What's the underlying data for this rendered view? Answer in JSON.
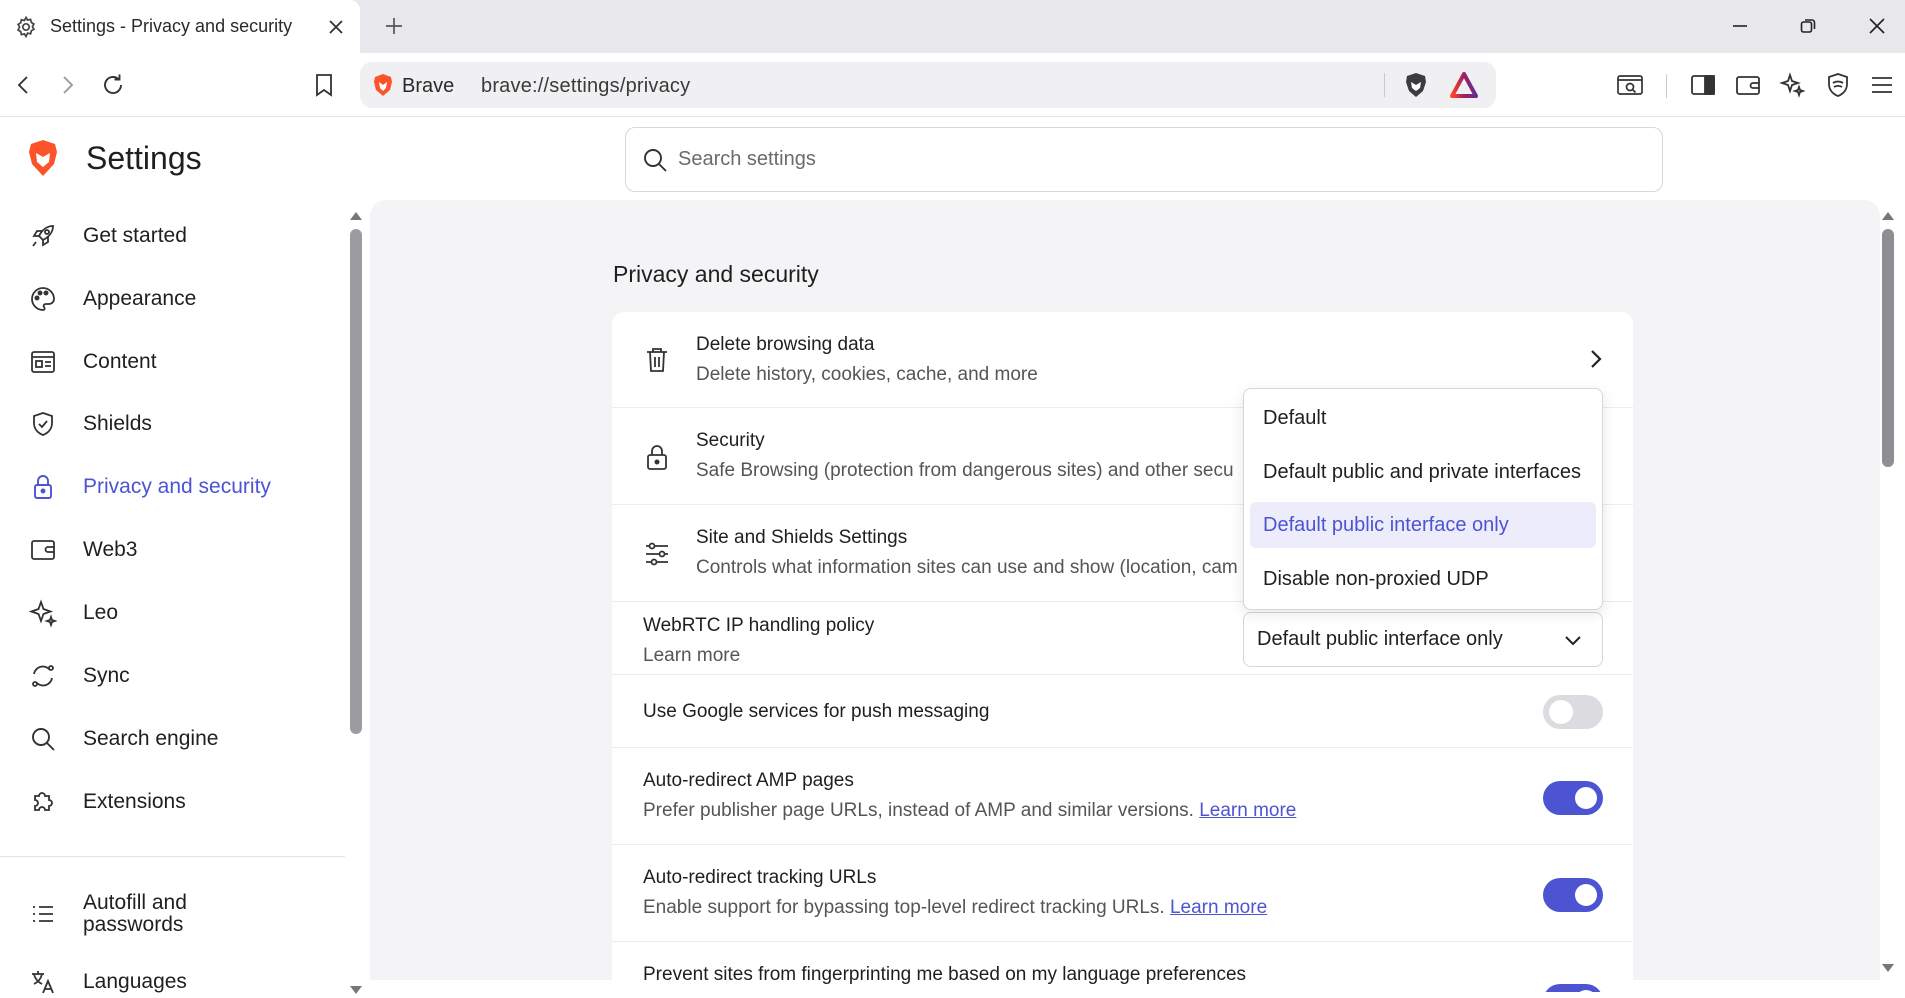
{
  "browser": {
    "tab_title": "Settings - Privacy and security",
    "brand_label": "Brave",
    "url": "brave://settings/privacy"
  },
  "settings": {
    "app_title": "Settings",
    "search_placeholder": "Search settings"
  },
  "sidebar": {
    "items": [
      {
        "label": "Get started",
        "icon": "rocket-icon"
      },
      {
        "label": "Appearance",
        "icon": "palette-icon"
      },
      {
        "label": "Content",
        "icon": "content-icon"
      },
      {
        "label": "Shields",
        "icon": "shield-icon"
      },
      {
        "label": "Privacy and security",
        "icon": "lock-icon",
        "active": true
      },
      {
        "label": "Web3",
        "icon": "wallet-icon"
      },
      {
        "label": "Leo",
        "icon": "sparkle-icon"
      },
      {
        "label": "Sync",
        "icon": "sync-icon"
      },
      {
        "label": "Search engine",
        "icon": "search-icon"
      },
      {
        "label": "Extensions",
        "icon": "puzzle-icon"
      }
    ],
    "secondary": [
      {
        "label": "Autofill and\npasswords",
        "icon": "list-icon"
      },
      {
        "label": "Languages",
        "icon": "translate-icon"
      }
    ]
  },
  "main": {
    "section_title": "Privacy and security",
    "rows": {
      "delete": {
        "title": "Delete browsing data",
        "sub": "Delete history, cookies, cache, and more"
      },
      "security": {
        "title": "Security",
        "sub": "Safe Browsing (protection from dangerous sites) and other secu"
      },
      "site": {
        "title": "Site and Shields Settings",
        "sub": "Controls what information sites can use and show (location, cam"
      },
      "webrtc": {
        "title": "WebRTC IP handling policy",
        "link": "Learn more",
        "selected": "Default public interface only"
      },
      "push": {
        "title": "Use Google services for push messaging",
        "enabled": false
      },
      "amp": {
        "title": "Auto-redirect AMP pages",
        "sub": "Prefer publisher page URLs, instead of AMP and similar versions.",
        "link": "Learn more",
        "enabled": true
      },
      "tracking": {
        "title": "Auto-redirect tracking URLs",
        "sub": "Enable support for bypassing top-level redirect tracking URLs.",
        "link": "Learn more",
        "enabled": true
      },
      "fingerprint": {
        "title": "Prevent sites from fingerprinting me based on my language preferences"
      }
    },
    "dropdown_options": [
      "Default",
      "Default public and private interfaces",
      "Default public interface only",
      "Disable non-proxied UDP"
    ]
  },
  "colors": {
    "accent": "#4c54d2",
    "brave_orange": "#fb542b"
  }
}
